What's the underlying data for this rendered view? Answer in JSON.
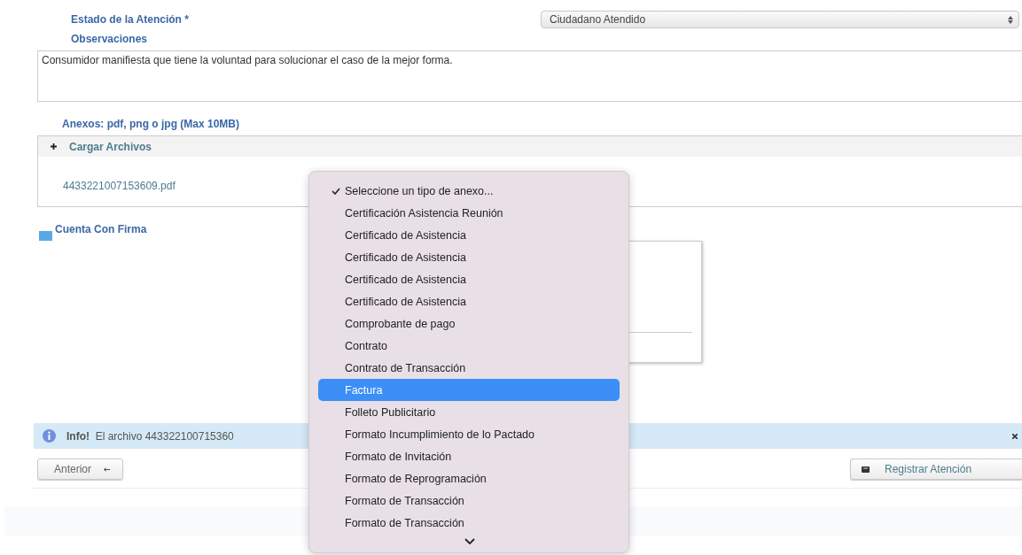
{
  "estado": {
    "label": "Estado de la Atención *",
    "value": "Ciudadano Atendido"
  },
  "observaciones": {
    "label": "Observaciones",
    "value": "Consumidor manifiesta que tiene la voluntad para solucionar el caso de la mejor forma."
  },
  "anexos": {
    "label": "Anexos: pdf, png o jpg (Max 10MB)",
    "upload_button": "Cargar Archivos",
    "files": [
      "4433221007153609.pdf"
    ]
  },
  "firma": {
    "label": "Cuenta Con Firma"
  },
  "alert": {
    "title": "Info!",
    "text": "El archivo 443322100715360"
  },
  "buttons": {
    "previous": "Anterior",
    "register": "Registrar Atención"
  },
  "dropdown": {
    "items": [
      {
        "label": "Seleccione un tipo de anexo...",
        "checked": true,
        "selected": false
      },
      {
        "label": "Certificación Asistencia Reunión",
        "checked": false,
        "selected": false
      },
      {
        "label": "Certificado de Asistencia",
        "checked": false,
        "selected": false
      },
      {
        "label": "Certificado de Asistencia",
        "checked": false,
        "selected": false
      },
      {
        "label": "Certificado de Asistencia",
        "checked": false,
        "selected": false
      },
      {
        "label": "Certificado de Asistencia",
        "checked": false,
        "selected": false
      },
      {
        "label": "Comprobante de pago",
        "checked": false,
        "selected": false
      },
      {
        "label": "Contrato",
        "checked": false,
        "selected": false
      },
      {
        "label": "Contrato de Transacción",
        "checked": false,
        "selected": false
      },
      {
        "label": "Factura",
        "checked": false,
        "selected": true
      },
      {
        "label": "Folleto Publicitario",
        "checked": false,
        "selected": false
      },
      {
        "label": "Formato Incumplimiento de lo Pactado",
        "checked": false,
        "selected": false
      },
      {
        "label": "Formato de Invitación",
        "checked": false,
        "selected": false
      },
      {
        "label": "Formato de Reprogramación",
        "checked": false,
        "selected": false
      },
      {
        "label": "Formato de Transacción",
        "checked": false,
        "selected": false
      },
      {
        "label": "Formato de Transacción",
        "checked": false,
        "selected": false
      }
    ]
  }
}
